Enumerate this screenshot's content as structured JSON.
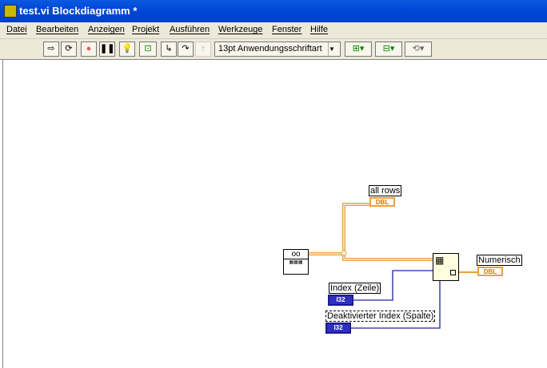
{
  "window": {
    "title": "test.vi Blockdiagramm *"
  },
  "menu": [
    "Datei",
    "Bearbeiten",
    "Anzeigen",
    "Projekt",
    "Ausführen",
    "Werkzeuge",
    "Fenster",
    "Hilfe"
  ],
  "toolbar": {
    "font_select": "13pt Anwendungsschriftart"
  },
  "diagram": {
    "all_rows_label": "all rows",
    "all_rows_type": "DBL",
    "numerisch_label": "Numerisch",
    "numerisch_type": "DBL",
    "index_row_label": "Index (Zeile)",
    "index_row_type": "I32",
    "index_col_label": "Deaktivierter Index (Spalte)",
    "index_col_type": "I32"
  },
  "colors": {
    "orange_wire": "#e8a040",
    "blue_wire": "#2020a0"
  }
}
